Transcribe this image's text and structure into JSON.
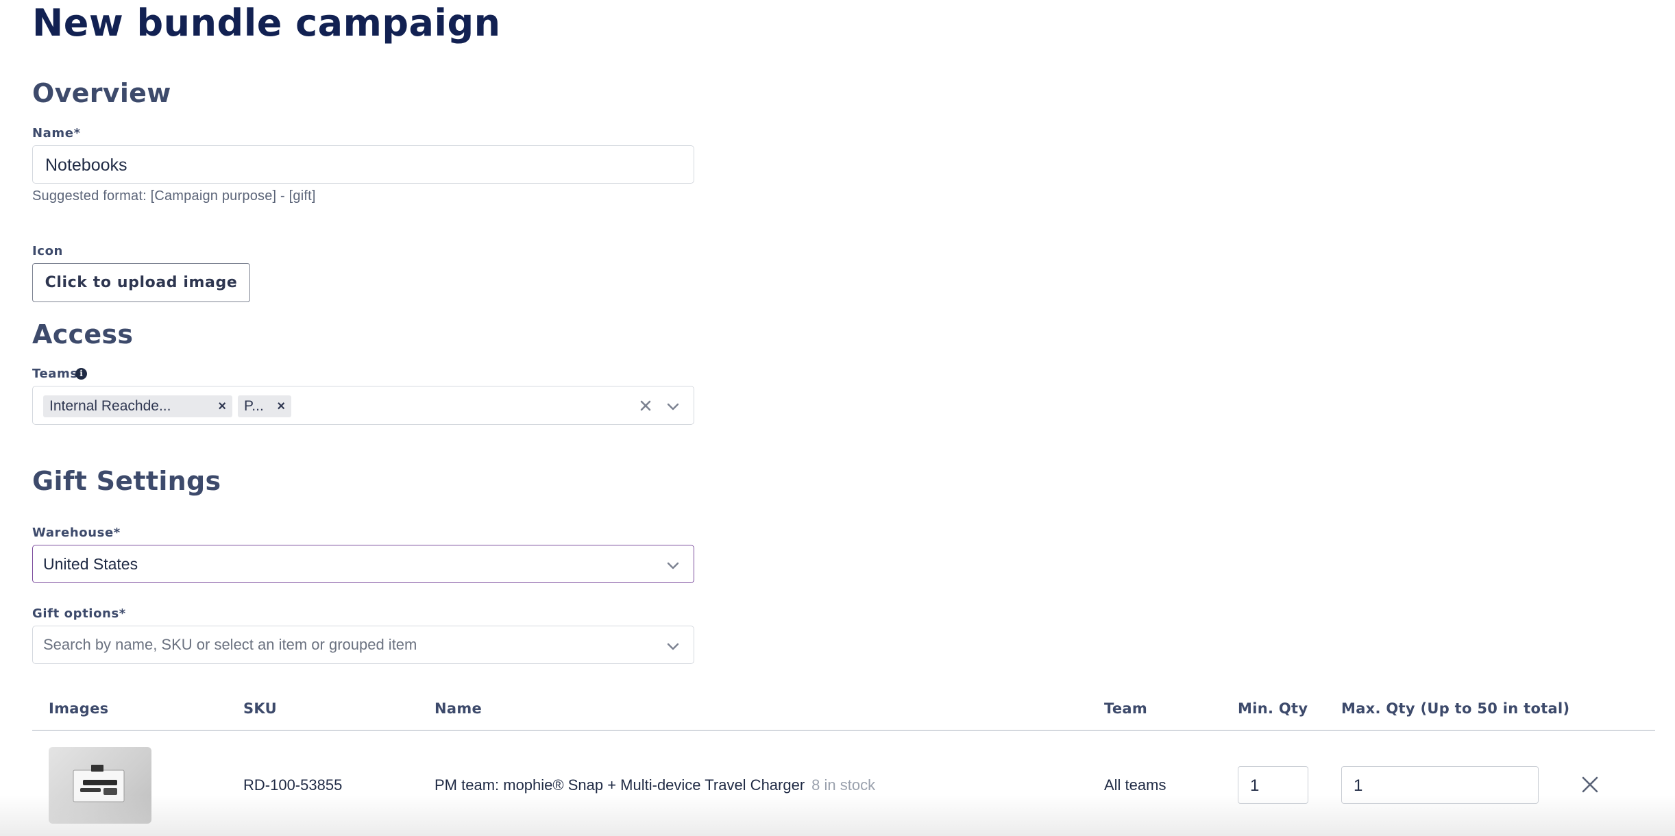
{
  "page": {
    "title": "New bundle campaign"
  },
  "overview": {
    "title": "Overview",
    "name_label": "Name*",
    "name_value": "Notebooks",
    "name_helper": "Suggested format: [Campaign purpose] - [gift]",
    "icon_label": "Icon",
    "upload_label": "Click to upload image"
  },
  "access": {
    "title": "Access",
    "teams_label": "Teams",
    "chips": [
      {
        "label": "Internal Reachde..."
      },
      {
        "label": "P..."
      }
    ]
  },
  "gift_settings": {
    "title": "Gift Settings",
    "warehouse_label": "Warehouse*",
    "warehouse_value": "United States",
    "gift_options_label": "Gift options*",
    "gift_options_placeholder": "Search by name, SKU or select an item or grouped item"
  },
  "table": {
    "headers": {
      "images": "Images",
      "sku": "SKU",
      "name": "Name",
      "team": "Team",
      "min_qty": "Min. Qty",
      "max_qty": "Max. Qty (Up to 50 in total)"
    },
    "rows": [
      {
        "sku": "RD-100-53855",
        "name": "PM team: mophie® Snap + Multi-device Travel Charger",
        "stock": "8 in stock",
        "team": "All teams",
        "min_qty": "1",
        "max_qty": "1"
      }
    ]
  },
  "colors": {
    "title": "#122152",
    "section": "#3d4a6b",
    "focus_border": "#7a4b9c",
    "border": "#d4d8de"
  },
  "icons": [
    "info-icon",
    "chip-close-icon",
    "clear-icon",
    "chevron-down-icon",
    "close-icon"
  ]
}
